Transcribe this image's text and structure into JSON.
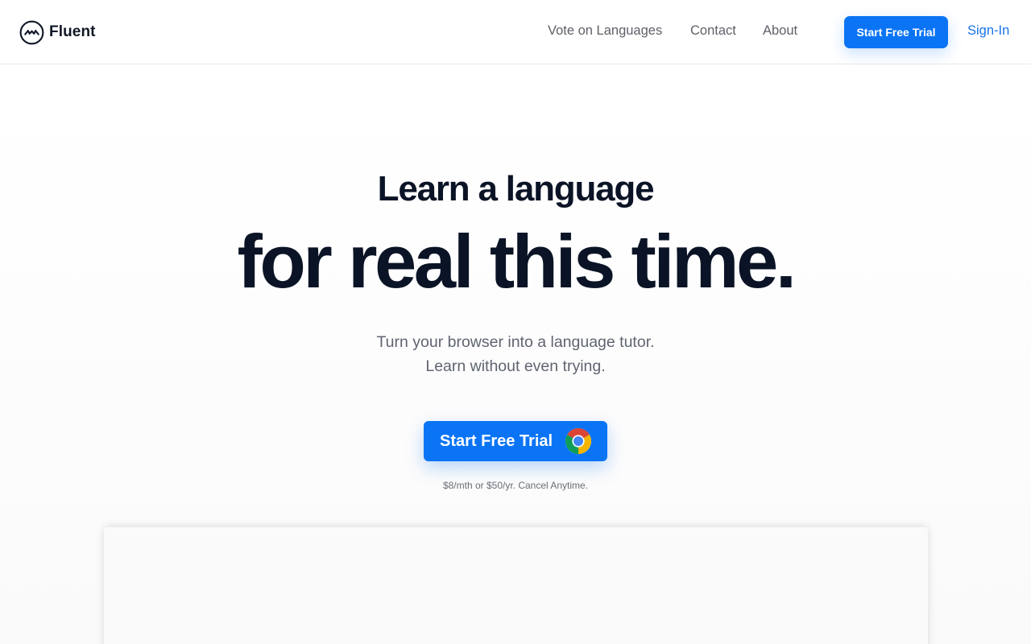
{
  "header": {
    "brand": "Fluent",
    "logo_icon": "fluent-logo-icon",
    "nav": {
      "vote": "Vote on Languages",
      "contact": "Contact",
      "about": "About"
    },
    "cta_label": "Start Free Trial",
    "signin_label": "Sign-In"
  },
  "hero": {
    "line1": "Learn a language",
    "line2": "for real this time.",
    "subtitle_line1": "Turn your browser into a language tutor.",
    "subtitle_line2": "Learn without even trying.",
    "cta_label": "Start Free Trial",
    "cta_icon": "chrome-icon",
    "pricing": "$8/mth or $50/yr. Cancel Anytime."
  },
  "colors": {
    "accent": "#0a74f5",
    "link": "#1a73e8",
    "heading": "#0b1426",
    "muted": "#5f6470"
  }
}
